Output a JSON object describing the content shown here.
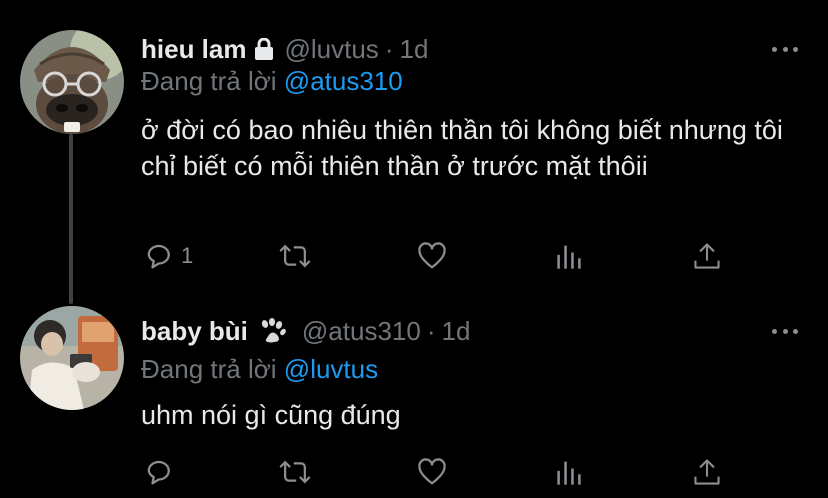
{
  "tweets": [
    {
      "display_name": "hieu lam",
      "badge": "lock-icon",
      "handle": "@luvtus",
      "separator": "·",
      "time": "1d",
      "reply_prefix": "Đang trả lời",
      "reply_to": "@atus310",
      "text": "ở đời có bao nhiêu thiên thần tôi không biết nhưng tôi chỉ biết có mỗi thiên thần ở trước mặt thôii",
      "reply_count": "1"
    },
    {
      "display_name": "baby bùi",
      "badge": "paw-icon",
      "handle": "@atus310",
      "separator": "·",
      "time": "1d",
      "reply_prefix": "Đang trả lời",
      "reply_to": "@luvtus",
      "text": "uhm nói gì cũng đúng",
      "reply_count": ""
    }
  ],
  "colors": {
    "background": "#000000",
    "text": "#e7e9ea",
    "muted": "#71767b",
    "link": "#1d9bf0",
    "icon": "#8b8f94"
  }
}
